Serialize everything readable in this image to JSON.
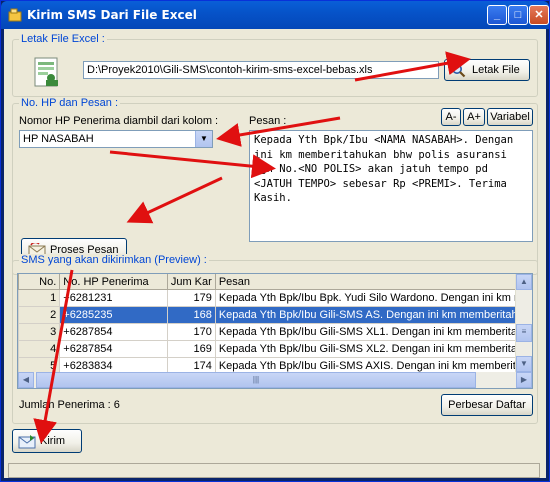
{
  "window": {
    "title": "Kirim SMS Dari File Excel",
    "controls": {
      "minimize": "_",
      "maximize": "□",
      "close": "✕"
    }
  },
  "file_group": {
    "label": "Letak File Excel :",
    "path": "D:\\Proyek2010\\Gili-SMS\\contoh-kirim-sms-excel-bebas.xls",
    "browse_button": "Letak File"
  },
  "message_group": {
    "label": "No. HP dan Pesan :",
    "column_label": "Nomor HP Penerima diambil dari kolom :",
    "column_value": "HP NASABAH",
    "pesan_label": "Pesan :",
    "font_smaller": "A-",
    "font_larger": "A+",
    "variable_button": "Variabel",
    "message_text": "Kepada Yth Bpk/Ibu <NAMA NASABAH>. Dengan ini km memberitahukan bhw polis asuransi dgn No.<NO POLIS> akan jatuh tempo pd <JATUH TEMPO> sebesar Rp <PREMI>. Terima Kasih.",
    "process_button": "Proses Pesan"
  },
  "preview_group": {
    "label": "SMS yang akan dikirimkan (Preview) :",
    "columns": [
      "No.",
      "No. HP Penerima",
      "Jum Kar",
      "Pesan"
    ],
    "rows": [
      {
        "no": "1",
        "hp": "+6281231",
        "jum": "179",
        "pesan": "Kepada Yth Bpk/Ibu Bpk. Yudi Silo Wardono. Dengan ini km m"
      },
      {
        "no": "2",
        "hp": "+6285235",
        "jum": "168",
        "pesan": "Kepada Yth Bpk/Ibu Gili-SMS AS. Dengan ini km memberitahu"
      },
      {
        "no": "3",
        "hp": "+6287854",
        "jum": "170",
        "pesan": "Kepada Yth Bpk/Ibu Gili-SMS XL1. Dengan ini km memberitah"
      },
      {
        "no": "4",
        "hp": "+6287854",
        "jum": "169",
        "pesan": "Kepada Yth Bpk/Ibu Gili-SMS XL2. Dengan ini km memberitah"
      },
      {
        "no": "5",
        "hp": "+6283834",
        "jum": "174",
        "pesan": "Kepada Yth Bpk/Ibu Gili-SMS AXIS. Dengan ini km memberitah"
      }
    ],
    "selected_row": 1,
    "total_label": "Jumlah Penerima : 6",
    "enlarge_button": "Perbesar Daftar"
  },
  "send_button": "Kirim",
  "colors": {
    "accent": "#0046d5",
    "arrow": "#e01010",
    "selection": "#316ac5"
  }
}
